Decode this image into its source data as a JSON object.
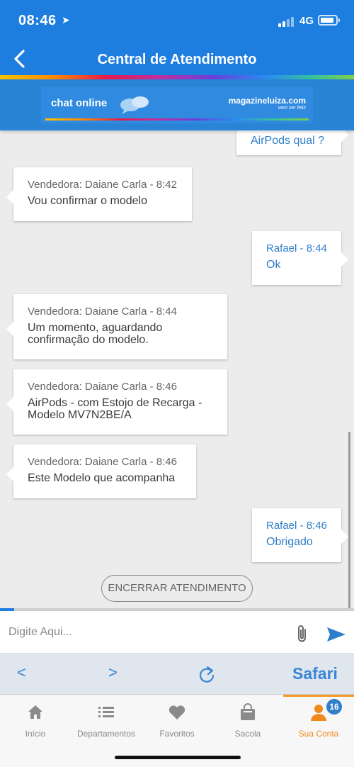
{
  "status": {
    "time": "08:46",
    "network": "4G"
  },
  "header": {
    "title": "Central de Atendimento"
  },
  "banner": {
    "left_text": "chat online",
    "brand": "magazineluiza.com",
    "tagline": "vem ser feliz"
  },
  "messages": [
    {
      "side": "out",
      "who": "",
      "text": "AirPods qual ?"
    },
    {
      "side": "in",
      "who": "Vendedora: Daiane Carla - 8:42",
      "text": "Vou confirmar o modelo"
    },
    {
      "side": "out",
      "who": "Rafael - 8:44",
      "text": "Ok"
    },
    {
      "side": "in",
      "who": "Vendedora: Daiane Carla - 8:44",
      "text": "Um momento, aguardando confirmação do modelo."
    },
    {
      "side": "in",
      "who": "Vendedora: Daiane Carla - 8:46",
      "text": "AirPods - com Estojo de Recarga - Modelo MV7N2BE/A"
    },
    {
      "side": "in",
      "who": "Vendedora: Daiane Carla - 8:46",
      "text": "Este Modelo que acompanha"
    },
    {
      "side": "out",
      "who": "Rafael - 8:46",
      "text": "Obrigado"
    }
  ],
  "end_button": "ENCERRAR ATENDIMENTO",
  "progress": 0.04,
  "input": {
    "placeholder": "Digite Aqui..."
  },
  "safari": {
    "back": "<",
    "forward": ">",
    "label": "Safari"
  },
  "nav": {
    "items": [
      {
        "label": "Início",
        "icon": "home-icon"
      },
      {
        "label": "Departamentos",
        "icon": "list-icon"
      },
      {
        "label": "Favoritos",
        "icon": "heart-icon"
      },
      {
        "label": "Sacola",
        "icon": "bag-icon"
      },
      {
        "label": "Sua Conta",
        "icon": "user-icon"
      }
    ],
    "badge": "16",
    "active_color": "#f08a1c"
  },
  "colors": {
    "header": "#1e7ee0",
    "accent": "#2f7ec9"
  }
}
